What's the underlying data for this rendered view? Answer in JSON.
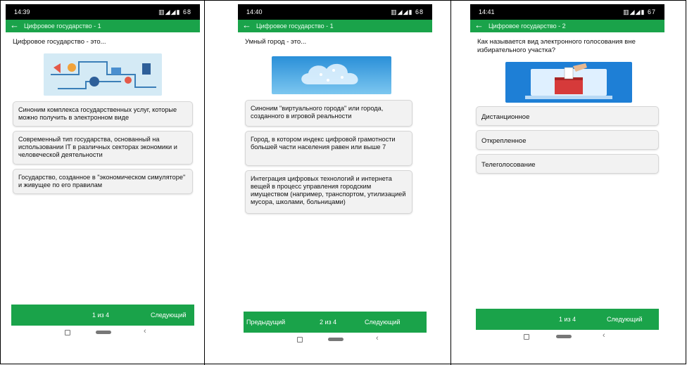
{
  "screens": [
    {
      "time": "14:39",
      "battery": "68",
      "title": "Цифровое государство - 1",
      "question": "Цифровое государство - это...",
      "answers": [
        "Синоним комплекса государственных услуг, которые можно получить в электронном виде",
        "Современный тип государства, основанный на использовании IT в различных секторах экономики и человеческой деятельности",
        "Государство, созданное в \"экономическом симуляторе\" и живущее по его правилам"
      ],
      "prev": "",
      "page": "1 из 4",
      "next": "Следующий"
    },
    {
      "time": "14:40",
      "battery": "68",
      "title": "Цифровое государство - 1",
      "question": "Умный город - это...",
      "answers": [
        "Синоним \"виртуального города\" или города, созданного в игровой реальности",
        "Город, в котором индекс цифровой грамотности большей части населения равен или выше 7",
        "Интеграция цифровых технологий и интернета вещей в процесс управления городским имуществом (например, транспортом, утилизацией мусора, школами, больницами)"
      ],
      "prev": "Предыдущий",
      "page": "2 из 4",
      "next": "Следующий"
    },
    {
      "time": "14:41",
      "battery": "67",
      "title": "Цифровое государство - 2",
      "question": "Как называется вид электронного голосования вне избирательного участка?",
      "answers": [
        "Дистанционное",
        "Открепленное",
        "Телеголосование"
      ],
      "prev": "",
      "page": "1 из 4",
      "next": "Следующий"
    }
  ],
  "icons": {
    "back": "arrow-left",
    "status": "signal-wifi-battery"
  },
  "colors": {
    "accent": "#1aa34a",
    "status_bar": "#000000",
    "answer_bg": "#f2f2f2"
  }
}
